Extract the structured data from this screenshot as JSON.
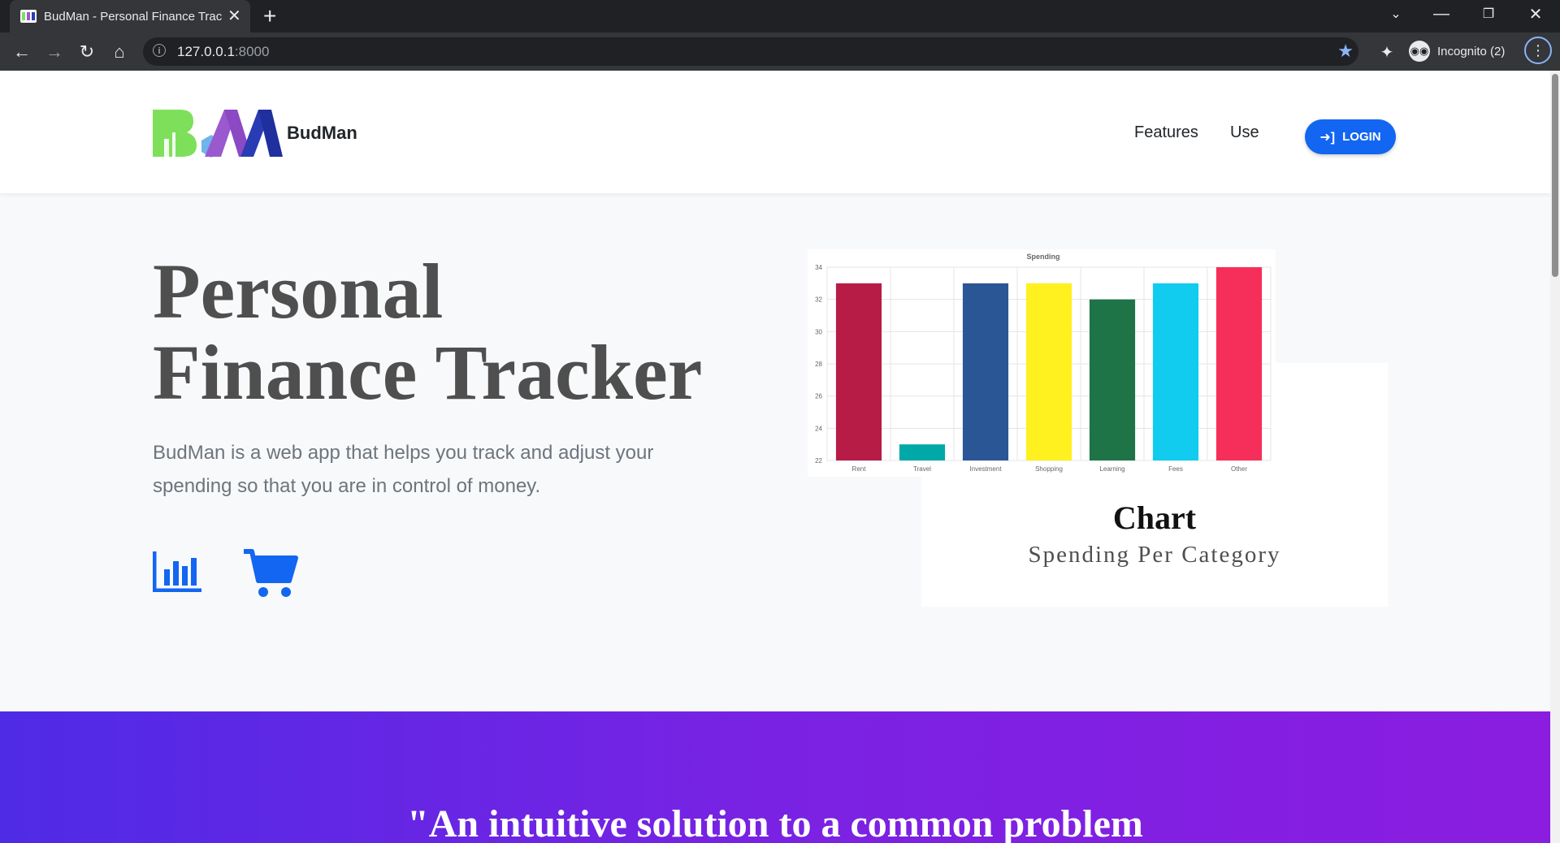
{
  "browser": {
    "tab_title": "BudMan - Personal Finance Tracker",
    "url_host": "127.0.0.1",
    "url_port": ":8000",
    "profile_label": "Incognito (2)"
  },
  "nav": {
    "brand": "BudMan",
    "links": [
      "Features",
      "Use"
    ],
    "login_label": "LOGIN"
  },
  "hero": {
    "title_line1": "Personal",
    "title_line2": "Finance Tracker",
    "description": "BudMan is a web app that helps you track and adjust your spending so that you are in control of money."
  },
  "card": {
    "title": "Chart",
    "subtitle": "Spending Per Category"
  },
  "banner": {
    "quote": "\"An intuitive solution to a common problem"
  },
  "colors": {
    "primary": "#1266f1",
    "logo_green": "#7ee05a",
    "logo_purple": "#9b59d0",
    "logo_blue": "#2a3cb3",
    "banner_start": "#4f2be6",
    "banner_end": "#8a1de0"
  },
  "icons": [
    "bar-chart-icon",
    "shopping-cart-icon",
    "sign-in-icon"
  ],
  "chart_data": {
    "type": "bar",
    "title": "Spending",
    "categories": [
      "Rent",
      "Travel",
      "Investment",
      "Shopping",
      "Learning",
      "Fees",
      "Other"
    ],
    "values": [
      33,
      23,
      33,
      33,
      32,
      33,
      34
    ],
    "colors": [
      "#b71c46",
      "#00a8a8",
      "#2b5695",
      "#fff01f",
      "#1e7447",
      "#11ccee",
      "#f62f5a"
    ],
    "yticks": [
      22,
      24,
      26,
      28,
      30,
      32,
      34
    ],
    "ylim": [
      22,
      34
    ],
    "grid": true
  }
}
